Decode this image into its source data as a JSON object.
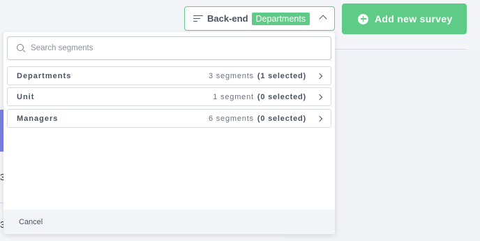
{
  "segment_selector": {
    "label": "Back-end",
    "selected_badge": "Departments"
  },
  "add_survey_button": {
    "label": "Add new survey"
  },
  "search": {
    "placeholder": "Search segments"
  },
  "segments": [
    {
      "name": "Departments",
      "count": "3 segments",
      "selected": "(1 selected)"
    },
    {
      "name": "Unit",
      "count": "1 segment",
      "selected": "(0 selected)"
    },
    {
      "name": "Managers",
      "count": "6 segments",
      "selected": "(0 selected)"
    }
  ],
  "footer": {
    "cancel_label": "Cancel"
  },
  "background": {
    "row_digits": [
      "3",
      "3"
    ]
  },
  "colors": {
    "accent_green": "#5ecb86",
    "border_green": "#64c98a",
    "side_purple": "#7c7fe0"
  }
}
